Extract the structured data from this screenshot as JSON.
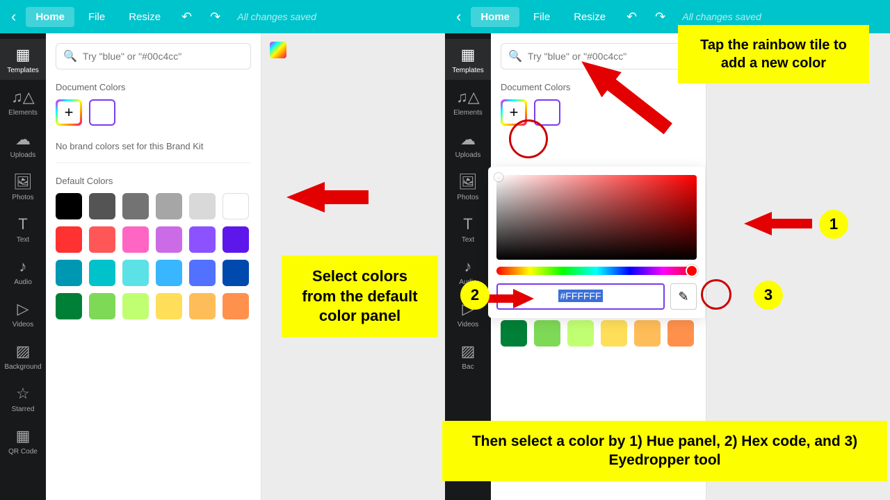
{
  "topbar": {
    "home": "Home",
    "file": "File",
    "resize": "Resize",
    "saved": "All changes saved"
  },
  "sidenav": [
    {
      "label": "Templates",
      "icon": "▦"
    },
    {
      "label": "Elements",
      "icon": "♫△"
    },
    {
      "label": "Uploads",
      "icon": "☁"
    },
    {
      "label": "Photos",
      "icon": "🖼"
    },
    {
      "label": "Text",
      "icon": "T"
    },
    {
      "label": "Audio",
      "icon": "♪"
    },
    {
      "label": "Videos",
      "icon": "▷"
    },
    {
      "label": "Background",
      "icon": "▨"
    },
    {
      "label": "Starred",
      "icon": "☆"
    },
    {
      "label": "QR Code",
      "icon": "▦"
    }
  ],
  "sidenav_right_extra": {
    "label": "Bac",
    "icon": "▨"
  },
  "search": {
    "placeholder": "Try \"blue\" or \"#00c4cc\""
  },
  "sections": {
    "doc_colors": "Document Colors",
    "brand_note": "No brand colors set for this Brand Kit",
    "default_colors": "Default Colors"
  },
  "default_colors": [
    "#000000",
    "#545454",
    "#737373",
    "#a6a6a6",
    "#d9d9d9",
    "#ffffff",
    "#ff3131",
    "#ff5757",
    "#ff66c4",
    "#cb6ce6",
    "#8c52ff",
    "#5e17eb",
    "#0097b2",
    "#00c2cb",
    "#5ce1e6",
    "#38b6ff",
    "#5271ff",
    "#004aad",
    "#008037",
    "#7ed957",
    "#c1ff72",
    "#ffde59",
    "#ffbd59",
    "#ff914d"
  ],
  "right_colors": [
    "#0097b2",
    "#00c2cb",
    "#5ce1e6",
    "#38b6ff",
    "#5271ff",
    "#004aad",
    "#008037",
    "#7ed957",
    "#c1ff72",
    "#ffde59",
    "#ffbd59",
    "#ff914d"
  ],
  "hex_value": "#FFFFFF",
  "callouts": {
    "left": "Select colors from the default color panel",
    "top_right": "Tap the rainbow tile to add a new color",
    "bottom": "Then select a color by 1) Hue panel, 2) Hex code, and 3) Eyedropper tool"
  },
  "badges": {
    "one": "1",
    "two": "2",
    "three": "3"
  }
}
